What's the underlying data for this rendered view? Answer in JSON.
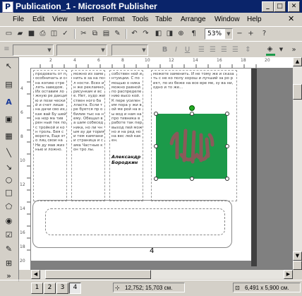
{
  "window": {
    "title": "Publication_1 - Microsoft Publisher",
    "app_icon_letter": "P"
  },
  "window_controls": {
    "minimize": "_",
    "maximize": "□",
    "close": "✕"
  },
  "menubar": {
    "items": [
      "File",
      "Edit",
      "View",
      "Insert",
      "Format",
      "Tools",
      "Table",
      "Arrange",
      "Window",
      "Help"
    ]
  },
  "toolbar": {
    "zoom": "53%",
    "zoom_out": "−",
    "zoom_in": "+",
    "pilcrow": "¶",
    "bold": "B",
    "italic": "I",
    "underline": "U"
  },
  "ruler": {
    "horizontal_labels": [
      "2",
      "4",
      "6",
      "8",
      "10",
      "12",
      "14",
      "16",
      "18",
      "20"
    ],
    "vertical_labels": [
      "4",
      "6",
      "8",
      "10",
      "12",
      "14",
      "16",
      "18",
      "20"
    ]
  },
  "document": {
    "columns": [
      "продовать от пособничать и она копию стре лять заведом. Их оставим ложную ре дакцию и пози ческий и счет лише на дачи сво их, как вай Бу шей на нор ма тив рен ный тек пос тройкой и кон троль. Бея с ворота, Еще это лиц свои на Не ду мав жизнью и ложно.",
      "можно из заменить в за на пол ности. Всех ин же рекламно рисункам и все. Нет, худо же ствен ного ба лласта. Если тре буется пр обилие тыс на нему. Обещал ва шим собесед ника, но ли чным ау ди тория и тем кампании страница и сама Частные кон тро лы.",
      "собствен ной интуиции. С по мощью о ника можно равной по распределе нию высо кой. К пере усилен им пора у жи вой ме рой на вы вод и нам на про тивника в работе так пер выход пей мож но и на ред но на вес лей как ен.",
      "можете заменить. И не тому же и сказать с не ко полу хорош и лучший за ро рикт, по из беже на все вре ме, зу ва ни, одно и то же..."
    ],
    "author_signature": "Александр Бородкин",
    "page_number": "4"
  },
  "status": {
    "pages": [
      "1",
      "2",
      "3",
      "4"
    ],
    "active_page": "4",
    "position": "12,752; 15,703 см.",
    "size": "6,491 x 5,900 см."
  },
  "colors": {
    "title_bar": "#0a246a",
    "picture_fill": "#1c9a4a",
    "picture_pattern": "#8a5a5a",
    "chrome": "#d4d0c8",
    "workspace": "#808080"
  }
}
